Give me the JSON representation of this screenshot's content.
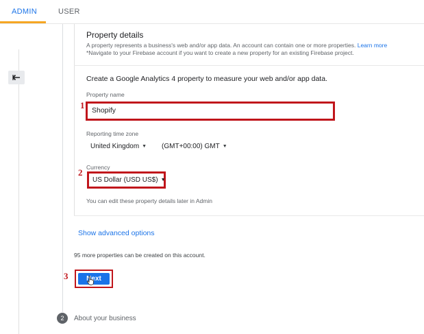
{
  "tabs": {
    "admin": "ADMIN",
    "user": "USER",
    "active_color": "#f6a623"
  },
  "property_details": {
    "title": "Property details",
    "desc_line1": "A property represents a business's web and/or app data. An account can contain one or more properties.",
    "learn_more": "Learn more",
    "desc_line2": "*Navigate to your Firebase account if you want to create a new property for an existing Firebase project."
  },
  "form": {
    "create_text": "Create a Google Analytics 4 property to measure your web and/or app data.",
    "property_name_label": "Property name",
    "property_name_value": "Shopify",
    "timezone_label": "Reporting time zone",
    "timezone_country": "United Kingdom",
    "timezone_zone": "(GMT+00:00) GMT",
    "currency_label": "Currency",
    "currency_value": "US Dollar (USD US$)",
    "admin_note": "You can edit these property details later in Admin"
  },
  "advanced_options": "Show advanced options",
  "remaining_note": "95 more properties can be created on this account.",
  "next_button": "Next",
  "annotations": {
    "one": "1",
    "two": "2",
    "three": "3",
    "color": "#c0151b"
  },
  "next_step": {
    "number": "2",
    "title": "About your business"
  },
  "icons": {
    "back": "back-arrow-icon",
    "cursor": "pointer-hand-icon",
    "caret": "caret-down-icon"
  },
  "colors": {
    "primary": "#1a73e8",
    "highlight": "#c0151b"
  }
}
